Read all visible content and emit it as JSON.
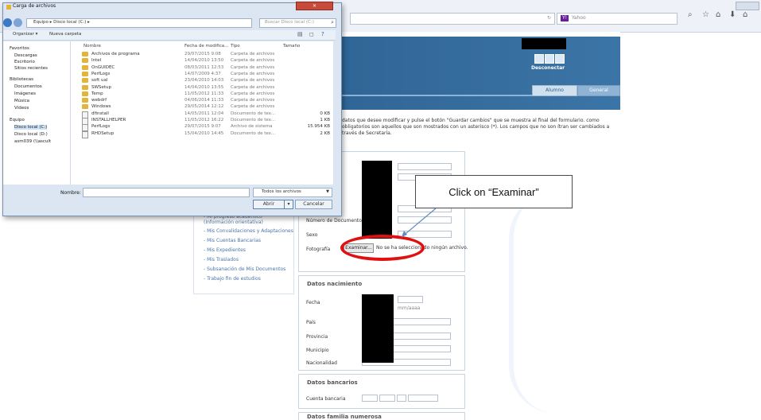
{
  "browser": {
    "search_placeholder": "Yahoo",
    "search_logo": "Y!",
    "icons": [
      "search-icon",
      "star-icon",
      "home-lock-icon",
      "download-icon",
      "home-icon"
    ]
  },
  "page": {
    "logout_label": "Desconectar",
    "tabs": [
      "Alumno",
      "General"
    ],
    "intro_text": "datos que desee modificar y pulse el botón \"Guardar cambios\" que se muestra al final del formulario. como obligatorios son aquellos que son mostrados con un asterisco (*). Los campos que no son ítran ser cambiados a través de Secretaría.",
    "sidebar": [
      "- Mi progreso académico (Información orientativa)",
      "- Mis Convalidaciones y Adaptaciones",
      "- Mis Cuentas Bancarias",
      "- Mis Expedientes",
      "- Mis Traslados",
      "- Subsanación de Mis Documentos",
      "- Trabajo fin de estudios"
    ],
    "form": {
      "numero_documento_label": "Número de Documento",
      "sexo_label": "Sexo",
      "fotografia_label": "Fotografía",
      "examinar_label": "Examinar...",
      "file_status": "No se ha seleccionado ningún archivo.",
      "section_nacimiento": "Datos nacimiento",
      "fecha_label": "Fecha",
      "fecha_hint": "mm/aaaa",
      "pais_label": "País",
      "provincia_label": "Provincia",
      "municipio_label": "Municipio",
      "nacionalidad_label": "Nacionalidad",
      "section_bancarios": "Datos bancarios",
      "cuenta_label": "Cuenta bancaria",
      "section_familia": "Datos familia numerosa"
    },
    "callout_text": "Click on “Examinar”"
  },
  "dialog": {
    "title": "Carga de archivos",
    "path": "Equipo ▸ Disco local (C:) ▸",
    "search_placeholder": "Buscar Disco local (C:)",
    "toolbar": {
      "organize": "Organizar ▾",
      "new_folder": "Nueva carpeta"
    },
    "nav": {
      "favoritos": "Favoritos",
      "descargas": "Descargas",
      "escritorio": "Escritorio",
      "sitios": "Sitios recientes",
      "bibliotecas": "Bibliotecas",
      "documentos": "Documentos",
      "imagenes": "Imágenes",
      "musica": "Música",
      "videos": "Vídeos",
      "equipo": "Equipo",
      "disco_c": "Disco local (C:)",
      "disco_d": "Disco local (D:)",
      "red": "asm039 (\\\\ascult"
    },
    "columns": [
      "Nombre",
      "Fecha de modifica...",
      "Tipo",
      "Tamaño"
    ],
    "files": [
      {
        "name": "Archivos de programa",
        "date": "29/07/2015 9:08",
        "type": "Carpeta de archivos",
        "size": "",
        "icon": "folder"
      },
      {
        "name": "Intel",
        "date": "14/04/2010 13:50",
        "type": "Carpeta de archivos",
        "size": "",
        "icon": "folder"
      },
      {
        "name": "OnGUIDEC",
        "date": "08/03/2011 12:53",
        "type": "Carpeta de archivos",
        "size": "",
        "icon": "folder"
      },
      {
        "name": "PerfLogs",
        "date": "14/07/2009 4:37",
        "type": "Carpeta de archivos",
        "size": "",
        "icon": "folder"
      },
      {
        "name": "soft ual",
        "date": "23/04/2010 14:03",
        "type": "Carpeta de archivos",
        "size": "",
        "icon": "folder"
      },
      {
        "name": "SWSetup",
        "date": "14/04/2010 13:55",
        "type": "Carpeta de archivos",
        "size": "",
        "icon": "folder"
      },
      {
        "name": "Temp",
        "date": "11/05/2012 11:33",
        "type": "Carpeta de archivos",
        "size": "",
        "icon": "folder"
      },
      {
        "name": "webdrf",
        "date": "04/06/2014 11:33",
        "type": "Carpeta de archivos",
        "size": "",
        "icon": "folder"
      },
      {
        "name": "Windows",
        "date": "29/05/2014 12:12",
        "type": "Carpeta de archivos",
        "size": "",
        "icon": "folder"
      },
      {
        "name": "dfinstall",
        "date": "14/05/2011 12:04",
        "type": "Documento de tex...",
        "size": "0 KB",
        "icon": "file"
      },
      {
        "name": "INSTALLHELPER",
        "date": "11/05/2012 16:22",
        "type": "Documento de tex...",
        "size": "1 KB",
        "icon": "file"
      },
      {
        "name": "PerfLogs",
        "date": "29/07/2015 9:07",
        "type": "Archivo de sistema",
        "size": "15.954 KB",
        "icon": "file"
      },
      {
        "name": "RHDSetup",
        "date": "15/04/2010 14:45",
        "type": "Documento de tex...",
        "size": "2 KB",
        "icon": "file"
      }
    ],
    "nombre_label": "Nombre:",
    "filter": "Todos los archivos",
    "open_label": "Abrir",
    "cancel_label": "Cancelar"
  }
}
